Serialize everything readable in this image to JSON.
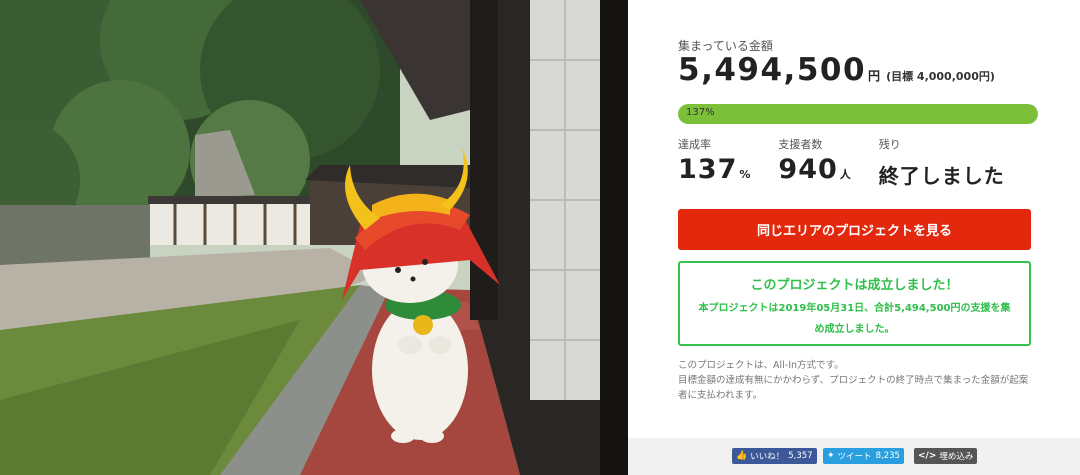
{
  "funding": {
    "collected_label": "集まっている金額",
    "amount": "5,494,500",
    "currency": "円",
    "goal": "(目標 4,000,000円)",
    "progress_text": "137%",
    "progress_fraction": 1.0
  },
  "stats": {
    "rate_label": "達成率",
    "rate_value": "137",
    "rate_unit": "%",
    "supporters_label": "支援者数",
    "supporters_value": "940",
    "supporters_unit": "人",
    "remaining_label": "残り",
    "remaining_value": "終了しました"
  },
  "area_button": {
    "label": "同じエリアのプロジェクトを見る"
  },
  "success": {
    "title": "このプロジェクトは成立しました！",
    "body": "本プロジェクトは2019年05月31日、合計5,494,500円の支援を集め成立しました。"
  },
  "note": {
    "line1": "このプロジェクトは、All-In方式です。",
    "line2": "目標金額の達成有無にかかわらず、プロジェクトの終了時点で集まった金額が起案者に支払われます。"
  },
  "share": {
    "facebook_label": "いいね！",
    "facebook_count": "5,357",
    "twitter_label": "ツイート",
    "twitter_count": "8,235",
    "embed_label": "埋め込み"
  },
  "colors": {
    "accent_red": "#e3280d",
    "progress_green": "#7cc03a",
    "success_green": "#2fbf4a"
  }
}
